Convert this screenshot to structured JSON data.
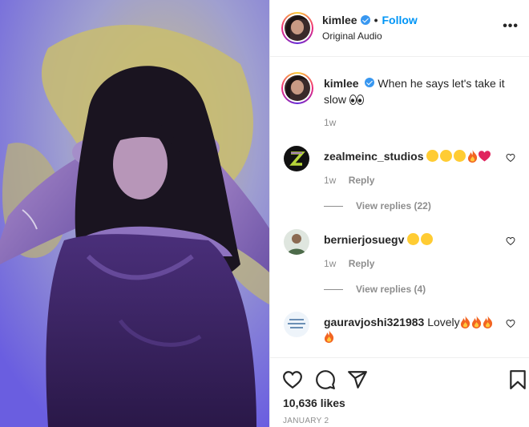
{
  "post": {
    "username": "kimlee",
    "follow_label": "Follow",
    "separator": "•",
    "audio": "Original Audio",
    "more_label": "•••"
  },
  "caption": {
    "username": "kimlee",
    "text": "When he says let's take it slow",
    "time": "1w"
  },
  "comments": [
    {
      "username": "zealmeinc_studios",
      "text": "",
      "time": "1w",
      "reply_label": "Reply",
      "replies_label": "View replies (22)"
    },
    {
      "username": "bernierjosuegv",
      "text": "",
      "time": "1w",
      "reply_label": "Reply",
      "replies_label": "View replies (4)"
    },
    {
      "username": "gauravjoshi321983",
      "text": "Lovely",
      "time": "",
      "reply_label": "",
      "replies_label": ""
    }
  ],
  "footer": {
    "likes": "10,636 likes",
    "date": "JANUARY 2"
  },
  "icons": [
    "more-icon",
    "heart-outline-icon",
    "comment-icon",
    "share-icon",
    "bookmark-icon",
    "verified-icon"
  ],
  "colors": {
    "follow": "#0095f6",
    "verified": "#3897f0",
    "muted": "#8e8e8e",
    "border": "#efefef"
  }
}
